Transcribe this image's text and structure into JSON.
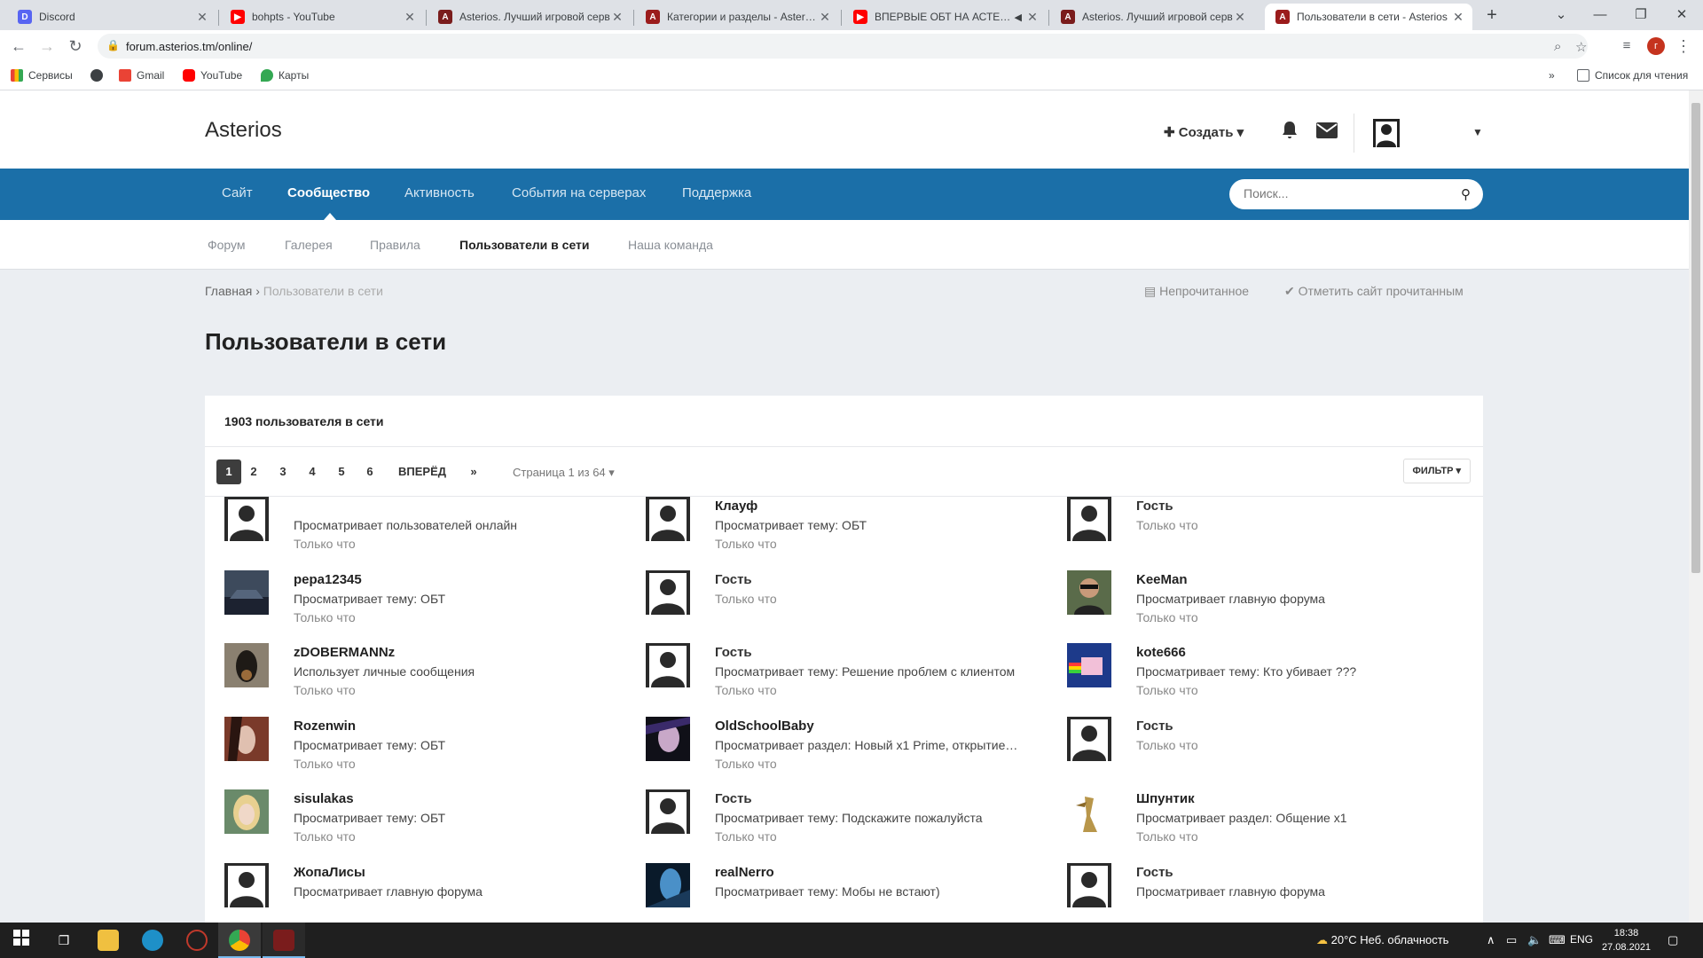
{
  "browser": {
    "tabs": [
      {
        "title": "Discord",
        "color": "#5865f2",
        "glyph": "D"
      },
      {
        "title": "bohpts - YouTube",
        "color": "#ff0000",
        "glyph": "▶"
      },
      {
        "title": "Asterios. Лучший игровой серв",
        "color": "#7a1c1c",
        "glyph": "A"
      },
      {
        "title": "Категории и разделы - Asterios",
        "color": "#9b1c1c",
        "glyph": "A"
      },
      {
        "title": "ВПЕРВЫЕ ОБТ НА АСТЕРИО",
        "color": "#ff0000",
        "glyph": "▶"
      },
      {
        "title": "Asterios. Лучший игровой серв",
        "color": "#7a1c1c",
        "glyph": "A"
      },
      {
        "title": "Пользователи в сети - Asterios",
        "color": "#9b1c1c",
        "glyph": "A"
      }
    ],
    "url": "forum.asterios.tm/online/",
    "profile_initial": "г",
    "bookmarks": [
      {
        "label": "Сервисы",
        "color": "#4285f4"
      },
      {
        "label": "Gmail",
        "color": "#ea4335"
      },
      {
        "label": "YouTube",
        "color": "#ff0000"
      },
      {
        "label": "Карты",
        "color": "#34a853"
      }
    ],
    "reading_list": "Список для чтения"
  },
  "site": {
    "logo": "Asterios",
    "create_label": "Создать",
    "main_nav": [
      "Сайт",
      "Сообщество",
      "Активность",
      "События на серверах",
      "Поддержка"
    ],
    "search_placeholder": "Поиск...",
    "sub_nav": [
      "Форум",
      "Галерея",
      "Правила",
      "Пользователи в сети",
      "Наша команда"
    ],
    "breadcrumb": {
      "home": "Главная",
      "current": "Пользователи в сети"
    },
    "unread": "Непрочитанное",
    "mark_read": "Отметить сайт прочитанным",
    "page_title": "Пользователи в сети",
    "online_count": "1903 пользователя в сети",
    "pagination": {
      "pages": [
        "1",
        "2",
        "3",
        "4",
        "5",
        "6"
      ],
      "next": "ВПЕРЁД",
      "last": "»",
      "info": "Страница 1 из 64",
      "filter": "ФИЛЬТР"
    },
    "users": [
      {
        "name": "",
        "activity": "Просматривает пользователей онлайн",
        "time": "Только что",
        "avatar": "default"
      },
      {
        "name": "Клауф",
        "activity": "Просматривает тему: ОБТ",
        "time": "Только что",
        "avatar": "default"
      },
      {
        "name": "Гость",
        "activity": "",
        "time": "Только что",
        "avatar": "default"
      },
      {
        "name": "pepa12345",
        "activity": "Просматривает тему: ОБТ",
        "time": "Только что",
        "avatar": "car"
      },
      {
        "name": "Гость",
        "activity": "",
        "time": "Только что",
        "avatar": "default"
      },
      {
        "name": "KeeMan",
        "activity": "Просматривает главную форума",
        "time": "Только что",
        "avatar": "man"
      },
      {
        "name": "zDOBERMANNz",
        "activity": "Использует личные сообщения",
        "time": "Только что",
        "avatar": "dog"
      },
      {
        "name": "Гость",
        "activity": "Просматривает тему: Решение проблем с клиентом",
        "time": "Только что",
        "avatar": "default"
      },
      {
        "name": "kote666",
        "activity": "Просматривает тему: Кто убивает ???",
        "time": "Только что",
        "avatar": "cat"
      },
      {
        "name": "Rozenwin",
        "activity": "Просматривает тему: ОБТ",
        "time": "Только что",
        "avatar": "girl"
      },
      {
        "name": "OldSchoolBaby",
        "activity": "Просматривает раздел: Новый x1 Prime, открытие…",
        "time": "Только что",
        "avatar": "dark"
      },
      {
        "name": "Гость",
        "activity": "",
        "time": "Только что",
        "avatar": "default"
      },
      {
        "name": "sisulakas",
        "activity": "Просматривает тему: ОБТ",
        "time": "Только что",
        "avatar": "blonde"
      },
      {
        "name": "Гость",
        "activity": "Просматривает тему: Подскажите пожалуйста",
        "time": "Только что",
        "avatar": "default"
      },
      {
        "name": "Шпунтик",
        "activity": "Просматривает раздел: Общение x1",
        "time": "Только что",
        "avatar": "gold"
      },
      {
        "name": "ЖопаЛисы",
        "activity": "Просматривает главную форума",
        "time": "",
        "avatar": "default"
      },
      {
        "name": "realNerro",
        "activity": "Просматривает тему: Мобы не встают)",
        "time": "",
        "avatar": "blue"
      },
      {
        "name": "Гость",
        "activity": "Просматривает главную форума",
        "time": "",
        "avatar": "default"
      }
    ]
  },
  "taskbar": {
    "weather": "20°C  Неб. облачность",
    "lang": "ENG",
    "time": "18:38",
    "date": "27.08.2021"
  }
}
